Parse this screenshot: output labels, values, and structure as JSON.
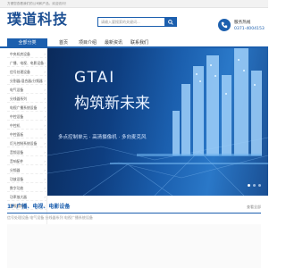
{
  "topbar": {
    "text": "方便您查看我们的公司和产品，欢迎访问！"
  },
  "header": {
    "logo": "璞道科技",
    "search": {
      "placeholder": "请输入要搜索的关键词...",
      "button_icon": "search-icon"
    },
    "hotline": {
      "label": "服务热线",
      "number": "0371-4004153"
    }
  },
  "nav": {
    "category_label": "全部分类",
    "items": [
      "首页",
      "项目介绍",
      "最新资讯",
      "联系我们"
    ]
  },
  "sidebar": {
    "items": [
      "中央机房设备",
      "广播、电视、电影设备",
      "信号处理设备",
      "分割器/混合器/分频器",
      "电气设备",
      "分线器系列",
      "电视广播系统设备",
      "中控设备",
      "中控机",
      "中控面板",
      "灯光控制系统设备",
      "音频设备",
      "音响配件",
      "分频器",
      "功放设备",
      "数字功放",
      "功率放大器",
      "音视频线缆"
    ]
  },
  "banner": {
    "tag": "GTAI",
    "title": "构筑新未来",
    "subtitle": "多点控制单元 · 高清摄像机 · 多向麦克风",
    "colors": {
      "dark": "#0b2a5a",
      "accent": "#2a78c8"
    },
    "slide_count": 3,
    "active_slide": 1
  },
  "section": {
    "title": "1F 广播、电视、电影设备",
    "more": "查看全部",
    "tabs": "信号处理设备   电气设备   分线器系列   电视广播系统设备"
  },
  "colors": {
    "brand": "#1c5fae",
    "logo": "#1c4f93"
  }
}
